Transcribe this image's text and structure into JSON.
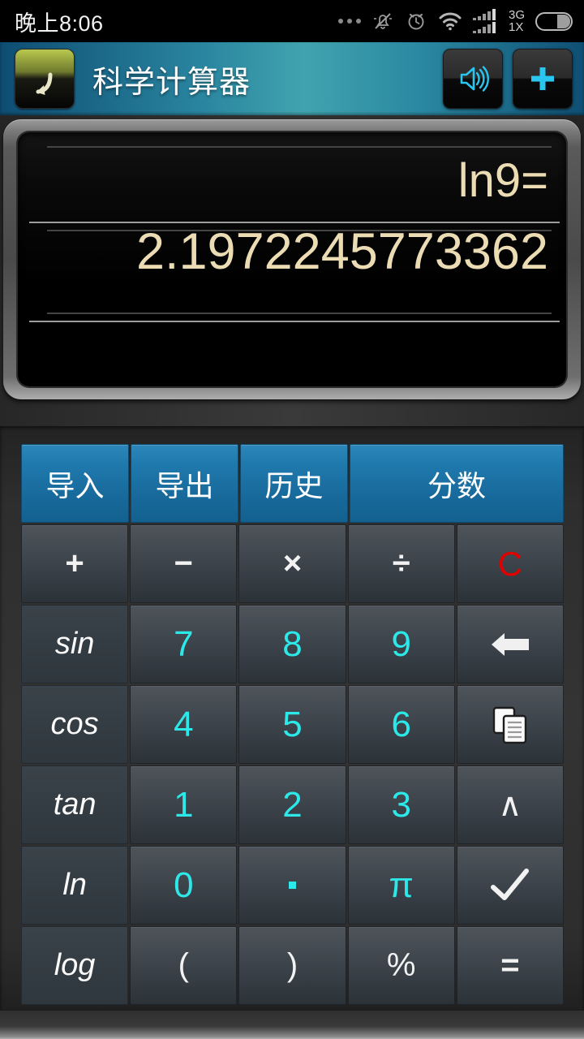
{
  "statusbar": {
    "time": "晚上8:06",
    "network_top": "3G",
    "network_bottom": "1X",
    "icons": [
      "more-dots-icon",
      "bell-muted-icon",
      "alarm-clock-icon",
      "wifi-icon",
      "signal-bars-icon",
      "battery-icon"
    ]
  },
  "titlebar": {
    "title": "科学计算器",
    "back_icon": "back-arrow-icon",
    "volume_icon": "speaker-volume-icon",
    "add_icon": "plus-icon",
    "accent_color": "#41a3ae",
    "edge_color": "#0e4d73"
  },
  "display": {
    "expression": "ln9=",
    "result": "2.1972245773362",
    "text_color": "#ecdcb4",
    "screen_color": "#000000"
  },
  "keypad": {
    "accent_blue": "#1f79ad",
    "number_color": "#2ce8e8",
    "clear_color": "#e00000",
    "rows": [
      [
        {
          "label": "导入",
          "name": "import-button",
          "style": "blue"
        },
        {
          "label": "导出",
          "name": "export-button",
          "style": "blue"
        },
        {
          "label": "历史",
          "name": "history-button",
          "style": "blue"
        },
        {
          "label": "分数",
          "name": "fraction-button",
          "style": "blue wide"
        }
      ],
      [
        {
          "label": "+",
          "name": "plus-button",
          "style": "dark op"
        },
        {
          "label": "−",
          "name": "minus-button",
          "style": "dark op"
        },
        {
          "label": "×",
          "name": "multiply-button",
          "style": "dark op"
        },
        {
          "label": "÷",
          "name": "divide-button",
          "style": "dark op"
        },
        {
          "label": "C",
          "name": "clear-button",
          "style": "dark red"
        }
      ],
      [
        {
          "label": "sin",
          "name": "sin-button",
          "style": "fn"
        },
        {
          "label": "7",
          "name": "digit-7-button",
          "style": "dark num"
        },
        {
          "label": "8",
          "name": "digit-8-button",
          "style": "dark num"
        },
        {
          "label": "9",
          "name": "digit-9-button",
          "style": "dark num"
        },
        {
          "label": "",
          "name": "backspace-button",
          "style": "dark",
          "icon": "backspace-arrow-icon"
        }
      ],
      [
        {
          "label": "cos",
          "name": "cos-button",
          "style": "fn"
        },
        {
          "label": "4",
          "name": "digit-4-button",
          "style": "dark num"
        },
        {
          "label": "5",
          "name": "digit-5-button",
          "style": "dark num"
        },
        {
          "label": "6",
          "name": "digit-6-button",
          "style": "dark num"
        },
        {
          "label": "",
          "name": "copy-button",
          "style": "dark",
          "icon": "copy-icon"
        }
      ],
      [
        {
          "label": "tan",
          "name": "tan-button",
          "style": "fn"
        },
        {
          "label": "1",
          "name": "digit-1-button",
          "style": "dark num"
        },
        {
          "label": "2",
          "name": "digit-2-button",
          "style": "dark num"
        },
        {
          "label": "3",
          "name": "digit-3-button",
          "style": "dark num"
        },
        {
          "label": "∧",
          "name": "power-button",
          "style": "dark"
        }
      ],
      [
        {
          "label": "ln",
          "name": "ln-button",
          "style": "fn"
        },
        {
          "label": "0",
          "name": "digit-0-button",
          "style": "dark num"
        },
        {
          "label": "·",
          "name": "decimal-point-button",
          "style": "dark num dot"
        },
        {
          "label": "π",
          "name": "pi-button",
          "style": "dark num"
        },
        {
          "label": "",
          "name": "confirm-button",
          "style": "dark",
          "icon": "check-icon"
        }
      ],
      [
        {
          "label": "log",
          "name": "log-button",
          "style": "fn"
        },
        {
          "label": "(",
          "name": "left-paren-button",
          "style": "dark"
        },
        {
          "label": ")",
          "name": "right-paren-button",
          "style": "dark"
        },
        {
          "label": "%",
          "name": "percent-button",
          "style": "dark"
        },
        {
          "label": "=",
          "name": "equals-button",
          "style": "dark op"
        }
      ]
    ]
  }
}
